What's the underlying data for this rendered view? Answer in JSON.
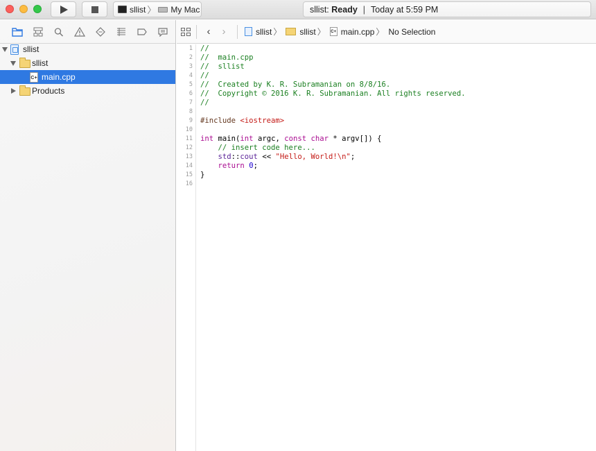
{
  "toolbar": {
    "scheme_target": "sllist",
    "scheme_device": "My Mac",
    "status_project": "sllist:",
    "status_state": "Ready",
    "status_separator": "|",
    "status_time": "Today at 5:59 PM"
  },
  "navigator": {
    "tree": [
      {
        "label": "sllist",
        "kind": "project"
      },
      {
        "label": "sllist",
        "kind": "folder"
      },
      {
        "label": "main.cpp",
        "kind": "file",
        "selected": true
      },
      {
        "label": "Products",
        "kind": "folder"
      }
    ]
  },
  "jumpbar": {
    "project": "sllist",
    "group": "sllist",
    "file": "main.cpp",
    "selection": "No Selection"
  },
  "editor": {
    "line_numbers": [
      "1",
      "2",
      "3",
      "4",
      "5",
      "6",
      "7",
      "8",
      "9",
      "10",
      "11",
      "12",
      "13",
      "14",
      "15",
      "16"
    ],
    "lines": [
      "//",
      "//  main.cpp",
      "//  sllist",
      "//",
      "//  Created by K. R. Subramanian on 8/8/16.",
      "//  Copyright © 2016 K. R. Subramanian. All rights reserved.",
      "//",
      "",
      "",
      "",
      "",
      "",
      "",
      "",
      "}",
      ""
    ],
    "tokens": {
      "include_directive": "#include ",
      "include_header": "<iostream>",
      "kw_int": "int",
      "main_sig_a": " main(",
      "kw_int2": "int",
      "main_sig_b": " argc, ",
      "kw_const": "const",
      "space": " ",
      "kw_char": "char",
      "main_sig_c": " * argv[]) {",
      "comment_insert": "    // insert code here...",
      "indent": "    ",
      "std_ns": "std",
      "scope": "::",
      "cout": "cout",
      "shift": " << ",
      "hello_str": "\"Hello, World!\\n\"",
      "semicolon": ";",
      "kw_return": "return",
      "zero": "0"
    },
    "colors": {
      "comment": "#1a7f20",
      "keyword": "#aa0d91",
      "string": "#c41a16",
      "number": "#1c00cf",
      "preprocessor": "#643820"
    }
  }
}
